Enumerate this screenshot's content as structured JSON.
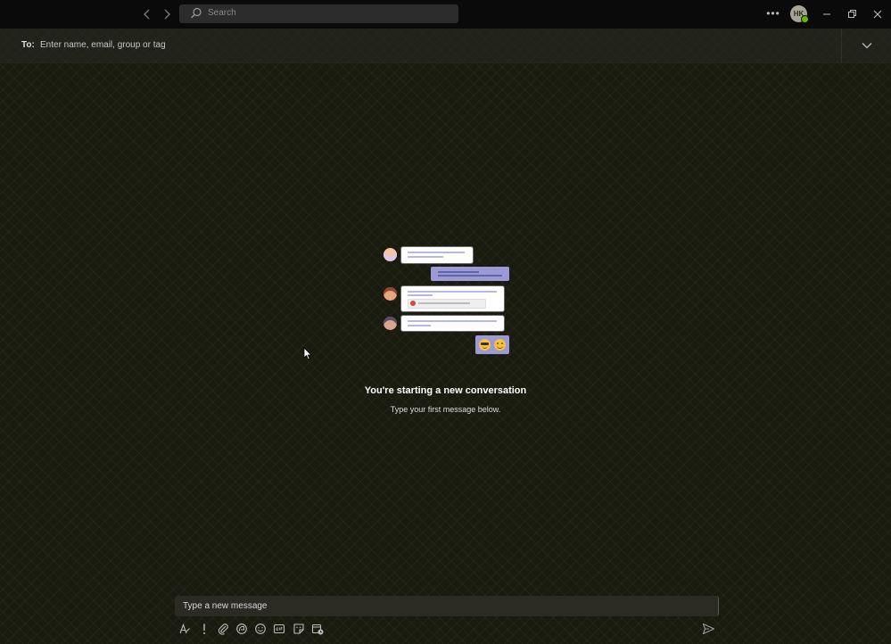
{
  "titlebar": {
    "back_icon": "chevron-left-icon",
    "forward_icon": "chevron-right-icon",
    "search_placeholder": "Search",
    "more_icon": "more-horizontal-icon",
    "avatar_initials": "HK",
    "presence_color": "#6bb700",
    "minimize_icon": "minimize-icon",
    "restore_icon": "restore-icon",
    "close_icon": "close-icon"
  },
  "recipient": {
    "label": "To:",
    "placeholder": "Enter name, email, group or tag",
    "expand_icon": "chevron-down-icon"
  },
  "empty_state": {
    "title": "You're starting a new conversation",
    "subtitle": "Type your first message below."
  },
  "compose": {
    "placeholder": "Type a new message",
    "toolbar": [
      "format-icon",
      "important-icon",
      "attach-icon",
      "loop-icon",
      "emoji-icon",
      "gif-icon",
      "sticker-icon",
      "schedule-meeting-icon"
    ],
    "send_icon": "send-icon"
  },
  "colors": {
    "background": "#1a1b0f",
    "accent": "#6264a7",
    "bubble_purple": "#9b9ad6"
  }
}
